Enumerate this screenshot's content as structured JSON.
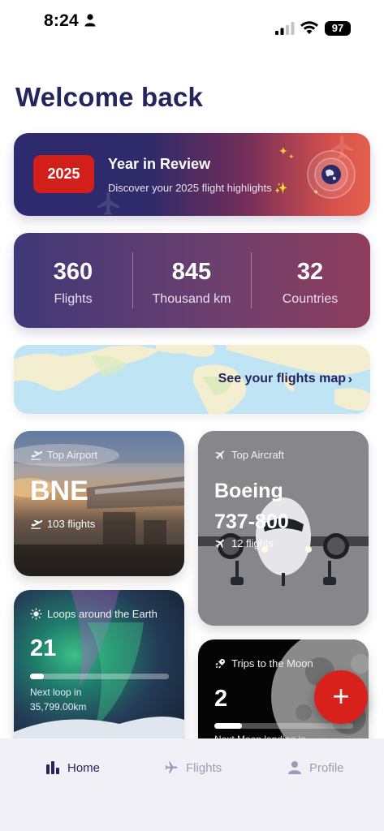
{
  "status_bar": {
    "time": "8:24",
    "battery": "97"
  },
  "page_title": "Welcome back",
  "review_card": {
    "year": "2025",
    "title": "Year in Review",
    "subtitle": "Discover your 2025 flight highlights ✨"
  },
  "stats": [
    {
      "value": "360",
      "label": "Flights"
    },
    {
      "value": "845",
      "label": "Thousand km"
    },
    {
      "value": "32",
      "label": "Countries"
    }
  ],
  "map_card": {
    "link_text": "See your flights map"
  },
  "top_airport": {
    "label": "Top Airport",
    "code": "BNE",
    "flights": "103 flights"
  },
  "top_aircraft": {
    "label": "Top Aircraft",
    "line1": "Boeing",
    "line2": "737-800",
    "flights": "12 flights"
  },
  "loops": {
    "label": "Loops around the Earth",
    "value": "21",
    "progress": 0.1,
    "next_line1": "Next loop in",
    "next_line2": "35,799.00km"
  },
  "moon": {
    "label": "Trips to the Moon",
    "value": "2",
    "progress": 0.2,
    "next_line": "Next Moon landing in"
  },
  "fab_icon": "plus-icon",
  "tab_bar": {
    "home": "Home",
    "flights": "Flights",
    "profile": "Profile"
  },
  "colors": {
    "brand_navy": "#26245e",
    "accent_red": "#d8211b",
    "tab_inactive": "#9d9bb6"
  }
}
